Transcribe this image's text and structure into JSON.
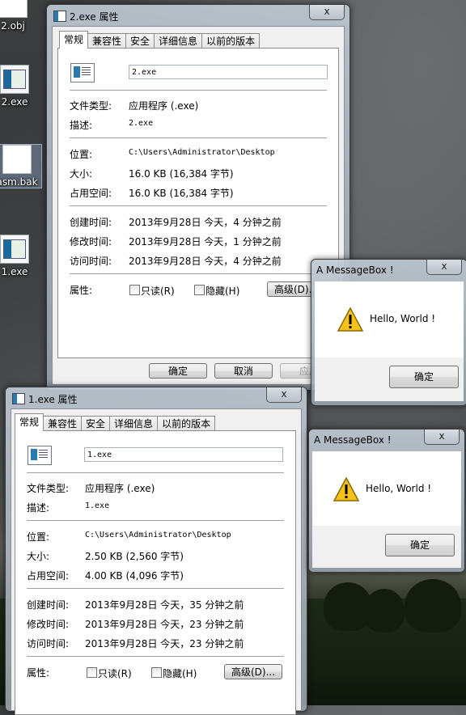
{
  "desktop": {
    "icons": [
      {
        "label": "2.obj"
      },
      {
        "label": "2.exe"
      },
      {
        "label": "asm.bak"
      },
      {
        "label": "1.exe"
      }
    ]
  },
  "prop2": {
    "title": "2.exe 属性",
    "close": "x",
    "tabs": [
      "常规",
      "兼容性",
      "安全",
      "详细信息",
      "以前的版本"
    ],
    "filename": "2.exe",
    "type_label": "文件类型:",
    "type_value": "应用程序 (.exe)",
    "desc_label": "描述:",
    "desc_value": "2.exe",
    "loc_label": "位置:",
    "loc_value": "C:\\Users\\Administrator\\Desktop",
    "size_label": "大小:",
    "size_value": "16.0 KB (16,384 字节)",
    "disk_label": "占用空间:",
    "disk_value": "16.0 KB (16,384 字节)",
    "created_label": "创建时间:",
    "created_value": "2013年9月28日 今天，4 分钟之前",
    "modified_label": "修改时间:",
    "modified_value": "2013年9月28日 今天，1 分钟之前",
    "accessed_label": "访问时间:",
    "accessed_value": "2013年9月28日 今天，4 分钟之前",
    "attr_label": "属性:",
    "readonly": "只读(R)",
    "hidden": "隐藏(H)",
    "advanced": "高级(D)...",
    "ok": "确定",
    "cancel": "取消",
    "apply": "应用"
  },
  "prop1": {
    "title": "1.exe 属性",
    "close": "x",
    "tabs": [
      "常规",
      "兼容性",
      "安全",
      "详细信息",
      "以前的版本"
    ],
    "filename": "1.exe",
    "type_label": "文件类型:",
    "type_value": "应用程序 (.exe)",
    "desc_label": "描述:",
    "desc_value": "1.exe",
    "loc_label": "位置:",
    "loc_value": "C:\\Users\\Administrator\\Desktop",
    "size_label": "大小:",
    "size_value": "2.50 KB (2,560 字节)",
    "disk_label": "占用空间:",
    "disk_value": "4.00 KB (4,096 字节)",
    "created_label": "创建时间:",
    "created_value": "2013年9月28日 今天，35 分钟之前",
    "modified_label": "修改时间:",
    "modified_value": "2013年9月28日 今天，23 分钟之前",
    "accessed_label": "访问时间:",
    "accessed_value": "2013年9月28日 今天，23 分钟之前",
    "attr_label": "属性:",
    "readonly": "只读(R)",
    "hidden": "隐藏(H)",
    "advanced": "高级(D)..."
  },
  "msgbox1": {
    "title": "A MessageBox !",
    "close": "x",
    "message": "Hello, World !",
    "ok": "确定"
  },
  "msgbox2": {
    "title": "A MessageBox !",
    "close": "x",
    "message": "Hello, World !",
    "ok": "确定"
  }
}
